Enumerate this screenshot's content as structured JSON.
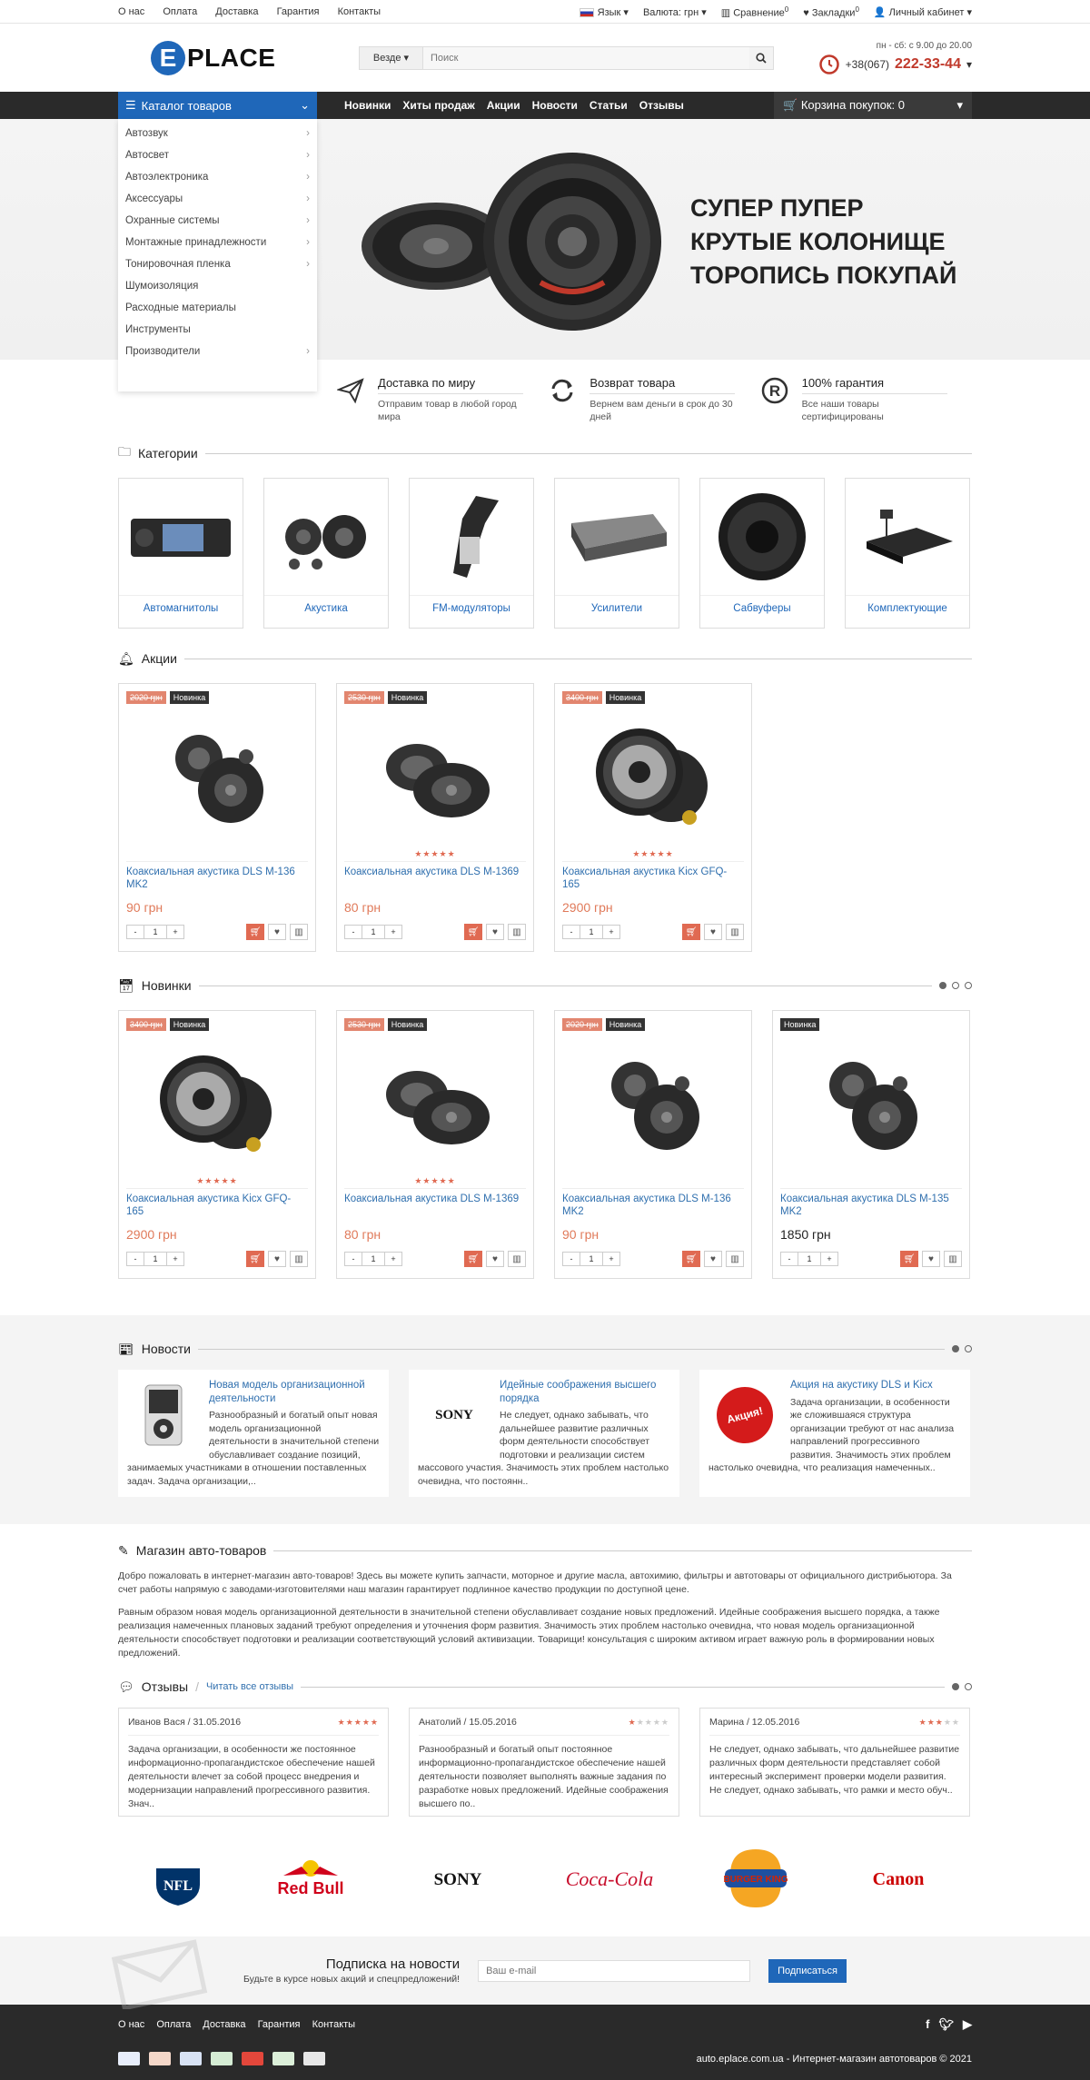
{
  "top": {
    "links": [
      "О нас",
      "Оплата",
      "Доставка",
      "Гарантия",
      "Контакты"
    ],
    "language": "Язык",
    "currency": "Валюта: грн",
    "compare": "Сравнение",
    "compare_count": "0",
    "bookmarks": "Закладки",
    "bookmarks_count": "0",
    "account": "Личный кабинет"
  },
  "header": {
    "logo_letter": "E",
    "logo_text": "PLACE",
    "search_category": "Везде",
    "search_placeholder": "Поиск",
    "hours": "пн - сб: с 9.00 до 20.00",
    "phone_prefix": "+38(067)",
    "phone_number": "222-33-44"
  },
  "nav": {
    "catalog": "Каталог товаров",
    "items": [
      "Новинки",
      "Хиты продаж",
      "Акции",
      "Новости",
      "Статьи",
      "Отзывы"
    ],
    "cart": "Корзина покупок: 0"
  },
  "catalog_menu": [
    {
      "label": "Автозвук",
      "sub": true
    },
    {
      "label": "Автосвет",
      "sub": true
    },
    {
      "label": "Автоэлектроника",
      "sub": true
    },
    {
      "label": "Аксессуары",
      "sub": true
    },
    {
      "label": "Охранные системы",
      "sub": true
    },
    {
      "label": "Монтажные принадлежности",
      "sub": true
    },
    {
      "label": "Тонировочная пленка",
      "sub": true
    },
    {
      "label": "Шумоизоляция",
      "sub": false
    },
    {
      "label": "Расходные материалы",
      "sub": false
    },
    {
      "label": "Инструменты",
      "sub": false
    },
    {
      "label": "Производители",
      "sub": true
    }
  ],
  "hero": {
    "line1": "СУПЕР ПУПЕР",
    "line2": "КРУТЫЕ КОЛОНИЩЕ",
    "line3": "ТОРОПИСЬ ПОКУПАЙ"
  },
  "features": [
    {
      "title": "Доставка по миру",
      "desc": "Отправим товар в любой город мира",
      "icon": "paper-plane-icon"
    },
    {
      "title": "Возврат товара",
      "desc": "Вернем вам деньги в срок до 30 дней",
      "icon": "refresh-icon"
    },
    {
      "title": "100% гарантия",
      "desc": "Все наши товары сертифицированы",
      "icon": "registered-icon"
    }
  ],
  "categories": {
    "title": "Категории",
    "items": [
      "Автомагнитолы",
      "Акустика",
      "FM-модуляторы",
      "Усилители",
      "Сабвуферы",
      "Комплектующие"
    ]
  },
  "promo": {
    "title": "Акции",
    "items": [
      {
        "old": "2020 грн",
        "badge": "Новинка",
        "name": "Коаксиальная акустика DLS M-136 MK2",
        "price": "90 грн",
        "stars": 0
      },
      {
        "old": "2530 грн",
        "badge": "Новинка",
        "name": "Коаксиальная акустика DLS M-1369",
        "price": "80 грн",
        "stars": 5
      },
      {
        "old": "3400 грн",
        "badge": "Новинка",
        "name": "Коаксиальная акустика Kicx GFQ-165",
        "price": "2900 грн",
        "stars": 5
      }
    ]
  },
  "new": {
    "title": "Новинки",
    "items": [
      {
        "old": "3400 грн",
        "badge": "Новинка",
        "name": "Коаксиальная акустика Kicx GFQ-165",
        "price": "2900 грн",
        "stars": 5
      },
      {
        "old": "2530 грн",
        "badge": "Новинка",
        "name": "Коаксиальная акустика DLS M-1369",
        "price": "80 грн",
        "stars": 5
      },
      {
        "old": "2020 грн",
        "badge": "Новинка",
        "name": "Коаксиальная акустика DLS M-136 MK2",
        "price": "90 грн",
        "stars": 0
      },
      {
        "old": "",
        "badge": "Новинка",
        "name": "Коаксиальная акустика DLS M-135 MK2",
        "price": "1850 грн",
        "stars": 0
      }
    ]
  },
  "qty": "1",
  "news": {
    "title": "Новости",
    "items": [
      {
        "title": "Новая модель организационной деятельности",
        "text": "Разнообразный и богатый опыт новая модель организационной деятельности в значительной степени обуславливает создание позиций, занимаемых участниками в отношении поставленных задач. Задача организации,.."
      },
      {
        "title": "Идейные соображения высшего порядка",
        "text": "Не следует, однако забывать, что дальнейшее развитие различных форм деятельности способствует подготовки и реализации систем массового участия. Значимость этих проблем настолько очевидна, что постоянн.."
      },
      {
        "title": "Акция на акустику DLS и Kicx",
        "text": "Задача организации, в особенности же сложившаяся структура организации требуют от нас анализа направлений прогрессивного развития. Значимость этих проблем настолько очевидна, что реализация намеченных.."
      }
    ],
    "sony_logo": "SONY",
    "promo_badge": "Акция!"
  },
  "about": {
    "title": "Магазин авто-товаров",
    "p1": "Добро пожаловать в интернет-магазин авто-товаров! Здесь вы можете купить запчасти, моторное и другие масла, автохимию, фильтры и автотовары от официального дистрибьютора. За счет работы напрямую с заводами-изготовителями наш магазин гарантирует подлинное качество продукции по доступной цене.",
    "p2": "Равным образом новая модель организационной деятельности в значительной степени обуславливает создание новых предложений. Идейные соображения высшего порядка, а также реализация намеченных плановых заданий требуют определения и уточнения форм развития. Значимость этих проблем настолько очевидна, что новая модель организационной деятельности способствует подготовки и реализации соответствующий условий активизации. Товарищи! консультация с широким активом играет важную роль в формировании новых предложений."
  },
  "reviews": {
    "title": "Отзывы",
    "all_link": "Читать все отзывы",
    "items": [
      {
        "author": "Иванов Вася / 31.05.2016",
        "rating": 5,
        "text": "Задача организации, в особенности же постоянное информационно-пропагандистское обеспечение нашей деятельности влечет за собой процесс внедрения и модернизации направлений прогрессивного развития. Знач.."
      },
      {
        "author": "Анатолий / 15.05.2016",
        "rating": 1,
        "text": "Разнообразный и богатый опыт постоянное информационно-пропагандистское обеспечение нашей деятельности позволяет выполнять важные задания по разработке новых предложений. Идейные соображения высшего по.."
      },
      {
        "author": "Марина / 12.05.2016",
        "rating": 3,
        "text": "Не следует, однако забывать, что дальнейшее развитие различных форм деятельности представляет собой интересный эксперимент проверки модели развития. Не следует, однако забывать, что рамки и место обуч.."
      }
    ]
  },
  "brands": [
    "NFL",
    "Red Bull",
    "SONY",
    "Coca-Cola",
    "BURGER KING",
    "Canon"
  ],
  "subscribe": {
    "title": "Подписка на новости",
    "desc": "Будьте в курсе новых акций и спецпредложений!",
    "placeholder": "Ваш e-mail",
    "button": "Подписаться"
  },
  "footer": {
    "links": [
      "О нас",
      "Оплата",
      "Доставка",
      "Гарантия",
      "Контакты"
    ],
    "copy": "auto.eplace.com.ua - Интернет-магазин автотоваров © 2021"
  },
  "colors": {
    "accent": "#1f67b9",
    "price": "#e07a5a",
    "dark": "#2a2a2a"
  }
}
